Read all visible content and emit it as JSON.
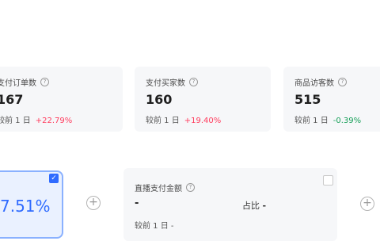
{
  "metrics": [
    {
      "title": "支付订单数",
      "value": "167",
      "compare_label": "较前 1 日",
      "delta": "+22.79%",
      "trend": "up"
    },
    {
      "title": "支付买家数",
      "value": "160",
      "compare_label": "较前 1 日",
      "delta": "+19.40%",
      "trend": "up"
    },
    {
      "title": "商品访客数",
      "value": "515",
      "compare_label": "较前 1 日",
      "delta": "-0.39%",
      "trend": "down"
    }
  ],
  "selected_card": {
    "value": "7.51%",
    "checked": true
  },
  "live_card": {
    "title": "直播支付金额",
    "value": "-",
    "share_label": "占比",
    "share_value": "-",
    "compare_label": "较前 1 日",
    "compare_value": "-",
    "checked": false
  },
  "icons": {
    "help": "help-circle-icon",
    "add": "plus-circle-icon",
    "check": "check-icon"
  },
  "colors": {
    "up": "#ff3d5e",
    "down": "#19a05a",
    "accent": "#2f6bff"
  }
}
